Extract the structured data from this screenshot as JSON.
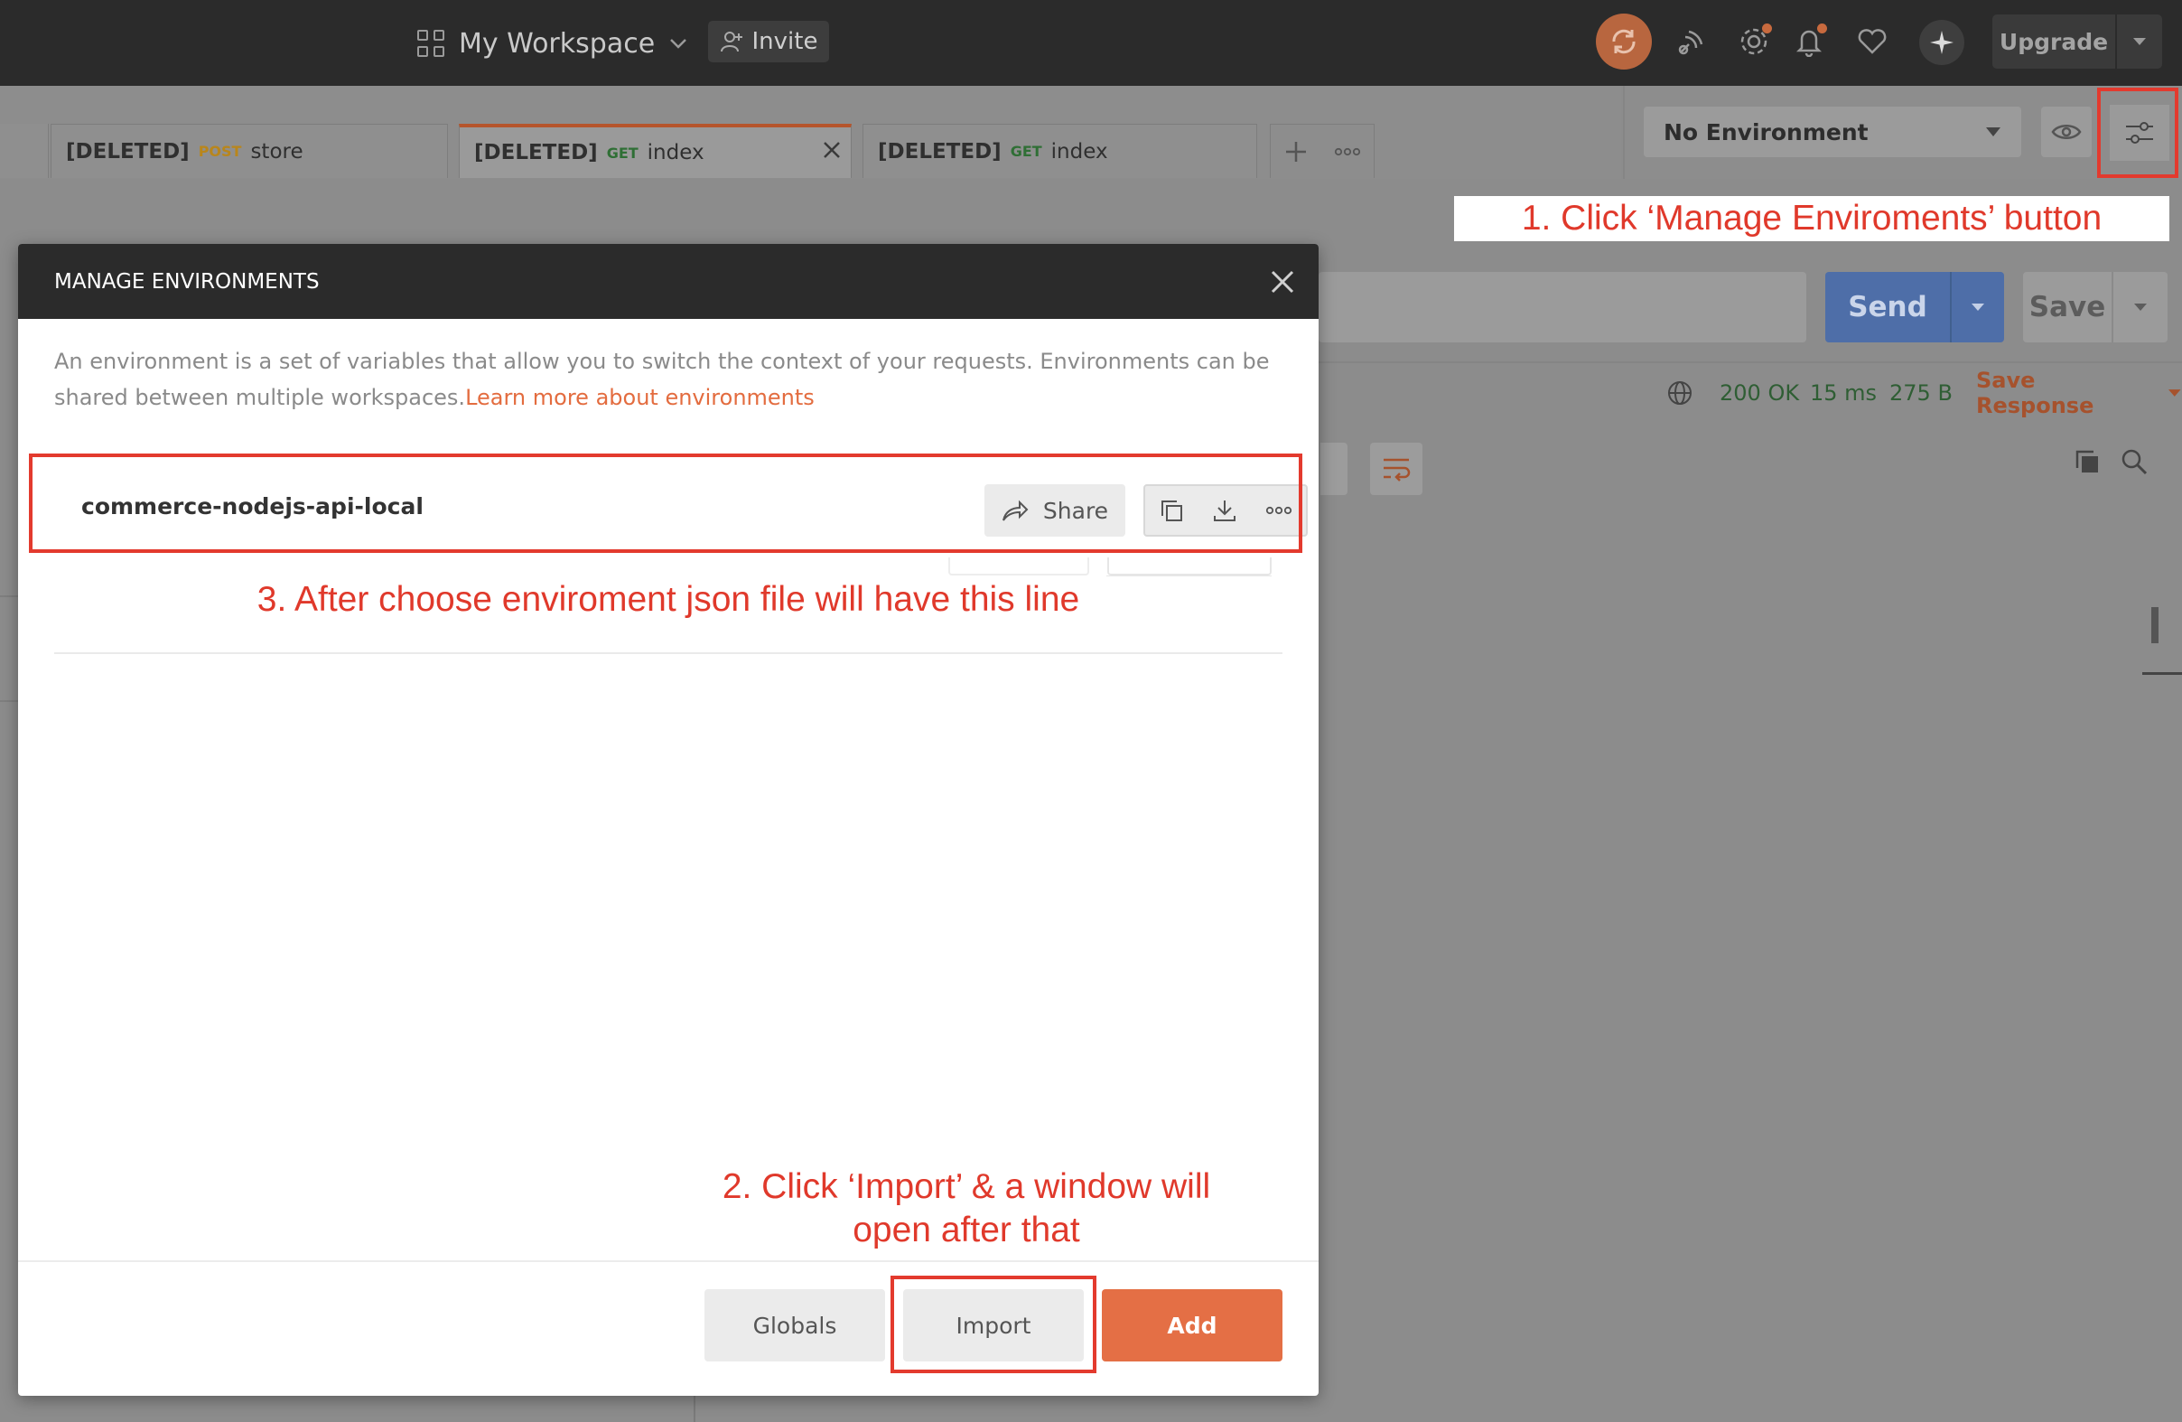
{
  "topbar": {
    "workspace_label": "My Workspace",
    "invite_label": "Invite",
    "upgrade_label": "Upgrade"
  },
  "tabs": [
    {
      "prefix": "[DELETED]",
      "method": "POST",
      "name": "store",
      "active": false
    },
    {
      "prefix": "[DELETED]",
      "method": "GET",
      "name": "index",
      "active": true
    },
    {
      "prefix": "[DELETED]",
      "method": "GET",
      "name": "index",
      "active": false
    }
  ],
  "environment": {
    "selected": "No Environment"
  },
  "request": {
    "send_label": "Send",
    "save_label": "Save"
  },
  "response": {
    "status": "200 OK",
    "time": "15 ms",
    "size": "275 B",
    "save_response_label": "Save Response"
  },
  "modal": {
    "title": "MANAGE ENVIRONMENTS",
    "description": "An environment is a set of variables that allow you to switch the context of your requests. Environments can be shared between multiple workspaces.",
    "learn_more_link": "Learn more about environments",
    "env_items": [
      {
        "name": "commerce-nodejs-api-local",
        "share_label": "Share"
      }
    ],
    "globals_label": "Globals",
    "import_label": "Import",
    "add_label": "Add"
  },
  "annotations": {
    "step1": "1. Click ‘Manage Enviroments’ button",
    "step2_line1": "2. Click ‘Import’ & a window will",
    "step2_line2": "open after that",
    "step3": "3. After choose enviroment json file will have this line"
  },
  "colors": {
    "accent": "#e46f45",
    "annotation_red": "#e0392b",
    "send_blue": "#4e6ea8",
    "topbar": "#2b2b2b"
  }
}
